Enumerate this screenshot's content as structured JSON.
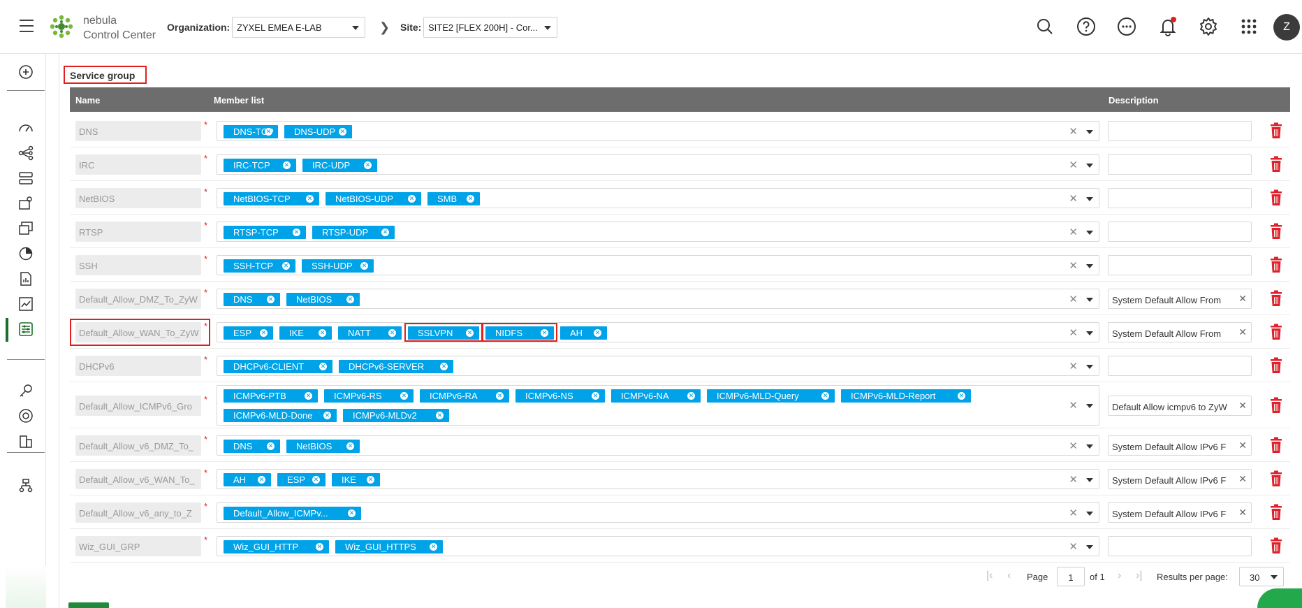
{
  "header": {
    "brand_line1": "nebula",
    "brand_line2": "Control Center",
    "org_label": "Organization:",
    "org_value": "ZYXEL EMEA E-LAB",
    "site_label": "Site:",
    "site_value": "SITE2 [FLEX 200H] - Cor...",
    "avatar_letter": "Z",
    "icons": [
      "search-icon",
      "help-icon",
      "more-icon",
      "notification-icon",
      "settings-icon",
      "apps-grid-icon"
    ]
  },
  "sidebar": {
    "icons": [
      "help-desk-icon",
      "dashboard-icon",
      "topology-icon",
      "devices-icon",
      "clients-icon",
      "monitor-icon",
      "analytics-icon",
      "report-icon",
      "trend-icon",
      "configure-icon",
      "license-icon",
      "support-icon",
      "organization-icon",
      "site-tree-icon"
    ]
  },
  "section_title": "Service group",
  "table": {
    "headers": {
      "name": "Name",
      "members": "Member list",
      "description": "Description"
    },
    "rows": [
      {
        "name": "DNS",
        "members": [
          "DNS-TCP",
          "DNS-UDP"
        ],
        "description": ""
      },
      {
        "name": "IRC",
        "members": [
          "IRC-TCP",
          "IRC-UDP"
        ],
        "description": ""
      },
      {
        "name": "NetBIOS",
        "members": [
          "NetBIOS-TCP",
          "NetBIOS-UDP",
          "SMB"
        ],
        "description": ""
      },
      {
        "name": "RTSP",
        "members": [
          "RTSP-TCP",
          "RTSP-UDP"
        ],
        "description": ""
      },
      {
        "name": "SSH",
        "members": [
          "SSH-TCP",
          "SSH-UDP"
        ],
        "description": ""
      },
      {
        "name": "Default_Allow_DMZ_To_ZyW",
        "members": [
          "DNS",
          "NetBIOS"
        ],
        "description": "System Default Allow From"
      },
      {
        "name": "Default_Allow_WAN_To_ZyW",
        "members": [
          "ESP",
          "IKE",
          "NATT",
          "SSLVPN",
          "NIDFS",
          "AH"
        ],
        "description": "System Default Allow From"
      },
      {
        "name": "DHCPv6",
        "members": [
          "DHCPv6-CLIENT",
          "DHCPv6-SERVER"
        ],
        "description": ""
      },
      {
        "name": "Default_Allow_ICMPv6_Gro",
        "members": [
          "ICMPv6-PTB",
          "ICMPv6-RS",
          "ICMPv6-RA",
          "ICMPv6-NS",
          "ICMPv6-NA",
          "ICMPv6-MLD-Query",
          "ICMPv6-MLD-Report",
          "ICMPv6-MLD-Done",
          "ICMPv6-MLDv2"
        ],
        "description": "Default Allow icmpv6 to ZyW"
      },
      {
        "name": "Default_Allow_v6_DMZ_To_",
        "members": [
          "DNS",
          "NetBIOS"
        ],
        "description": "System Default Allow IPv6 F"
      },
      {
        "name": "Default_Allow_v6_WAN_To_",
        "members": [
          "AH",
          "ESP",
          "IKE"
        ],
        "description": "System Default Allow IPv6 F"
      },
      {
        "name": "Default_Allow_v6_any_to_Z",
        "members": [
          "Default_Allow_ICMPv..."
        ],
        "description": "System Default Allow IPv6 F"
      },
      {
        "name": "Wiz_GUI_GRP",
        "members": [
          "Wiz_GUI_HTTP",
          "Wiz_GUI_HTTPS"
        ],
        "description": ""
      }
    ]
  },
  "pagination": {
    "page_label": "Page",
    "page_value": "1",
    "of_label": "of 1",
    "results_label": "Results per page:",
    "results_value": "30"
  },
  "colors": {
    "tag": "#00a2e8",
    "header_bg": "#6d6d6d",
    "trash": "#e0202a",
    "highlight": "#e02020",
    "brand_green": "#1e8a3a"
  }
}
